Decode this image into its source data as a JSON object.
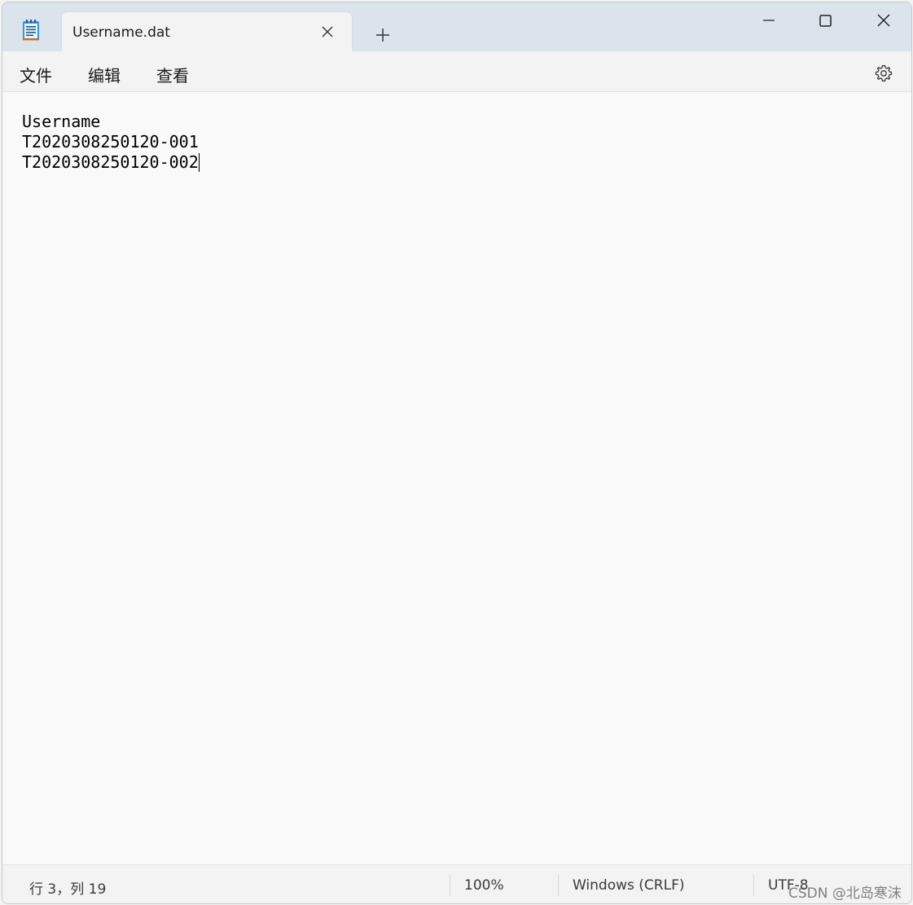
{
  "tab": {
    "title": "Username.dat"
  },
  "menu": {
    "file": "文件",
    "edit": "编辑",
    "view": "查看"
  },
  "editor": {
    "lines": [
      "Username",
      "T2020308250120-001",
      "T2020308250120-002"
    ]
  },
  "status": {
    "position": "行 3，列 19",
    "zoom": "100%",
    "line_ending": "Windows (CRLF)",
    "encoding": "UTF-8"
  },
  "watermark": "CSDN @北岛寒沫",
  "icons": {
    "app": "notepad-icon",
    "tab_close": "close-icon",
    "new_tab": "plus-icon",
    "minimize": "minimize-icon",
    "maximize": "maximize-icon",
    "close": "close-icon",
    "settings": "gear-icon"
  }
}
